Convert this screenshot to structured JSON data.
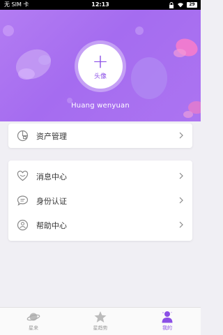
{
  "status_bar": {
    "carrier": "无 SIM 卡",
    "time": "12:13",
    "battery": "29"
  },
  "profile": {
    "avatar_plus": "+",
    "avatar_label": "头像",
    "username": "Huang wenyuan"
  },
  "menu_top": [
    {
      "label": "资产管理",
      "icon": "wallet-icon"
    }
  ],
  "menu_main": [
    {
      "label": "消息中心",
      "icon": "heart-icon"
    },
    {
      "label": "身份认证",
      "icon": "chat-bubble-icon"
    },
    {
      "label": "帮助中心",
      "icon": "help-person-icon"
    }
  ],
  "tabs": [
    {
      "label": "星来",
      "icon": "planet-icon",
      "active": false
    },
    {
      "label": "星趋势",
      "icon": "star-icon",
      "active": false
    },
    {
      "label": "我的",
      "icon": "person-icon",
      "active": true
    }
  ],
  "colors": {
    "accent": "#8b4fe6",
    "header_bg": "#a56cf0",
    "icon_gray": "#888888"
  }
}
